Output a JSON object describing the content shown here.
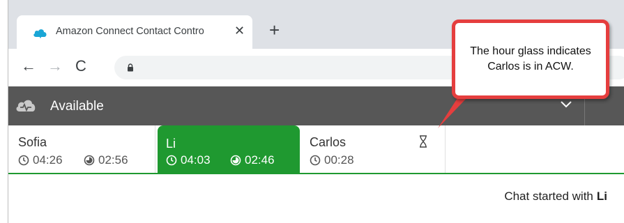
{
  "browser": {
    "tab_title": "Amazon Connect Contact Contro",
    "tab_close": "✕",
    "new_tab": "+",
    "nav_back": "←",
    "nav_forward": "→",
    "nav_reload": "C"
  },
  "ccp": {
    "status_label": "Available",
    "contacts": [
      {
        "name": "Sofia",
        "timers": [
          "04:26",
          "02:56"
        ],
        "state": "inactive"
      },
      {
        "name": "Li",
        "timers": [
          "04:03",
          "02:46"
        ],
        "state": "active"
      },
      {
        "name": "Carlos",
        "timers": [
          "00:28"
        ],
        "state": "acw",
        "status_icon": "hourglass-icon"
      }
    ],
    "chat_status_prefix": "Chat started with",
    "chat_status_name": "Li"
  },
  "callout": {
    "text": "The hour glass indicates Carlos is in ACW."
  },
  "colors": {
    "active_tab": "#1f9930",
    "header": "#575757",
    "callout_border": "#e53e3e"
  }
}
